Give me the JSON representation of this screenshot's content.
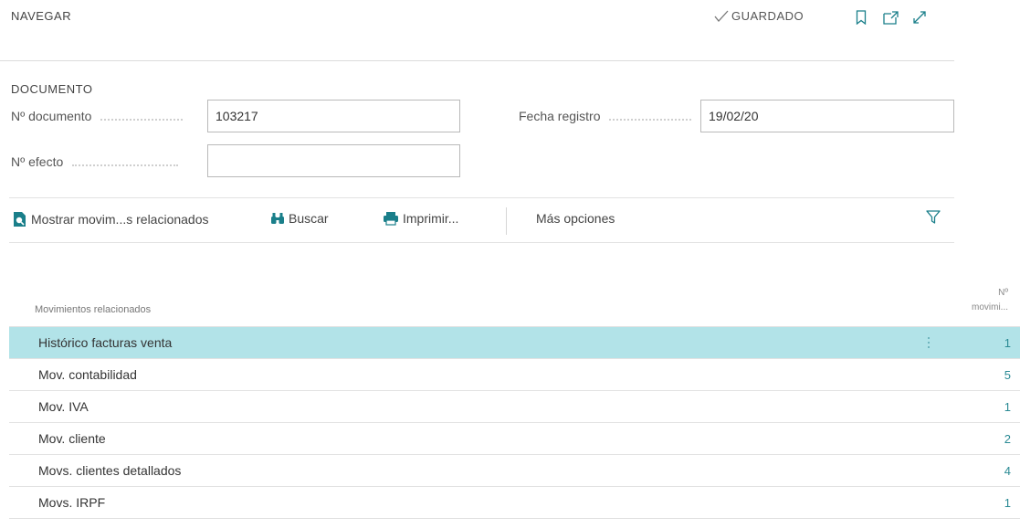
{
  "header": {
    "title": "NAVEGAR",
    "saved_label": "GUARDADO",
    "icons": [
      "bookmark-icon",
      "open-new-window-icon",
      "expand-icon"
    ]
  },
  "document": {
    "section_title": "DOCUMENTO",
    "doc_number_label": "Nº documento",
    "doc_number_value": "103217",
    "posting_date_label": "Fecha registro",
    "posting_date_value": "19/02/20",
    "effect_number_label": "Nº efecto",
    "effect_number_value": ""
  },
  "actions": {
    "show_related": "Mostrar movim...s relacionados",
    "search": "Buscar",
    "print": "Imprimir...",
    "more_options": "Más opciones"
  },
  "list": {
    "column_label": "Movimientos relacionados",
    "column_count_line1": "Nº",
    "column_count_line2": "movimi...",
    "rows": [
      {
        "label": "Histórico facturas venta",
        "count": "1"
      },
      {
        "label": "Mov. contabilidad",
        "count": "5"
      },
      {
        "label": "Mov. IVA",
        "count": "1"
      },
      {
        "label": "Mov. cliente",
        "count": "2"
      },
      {
        "label": "Movs. clientes detallados",
        "count": "4"
      },
      {
        "label": "Movs. IRPF",
        "count": "1"
      }
    ]
  },
  "colors": {
    "selected_row": "#b2e3e8",
    "count_link": "#2a8a94",
    "accent_icon": "#1a7f8a"
  }
}
